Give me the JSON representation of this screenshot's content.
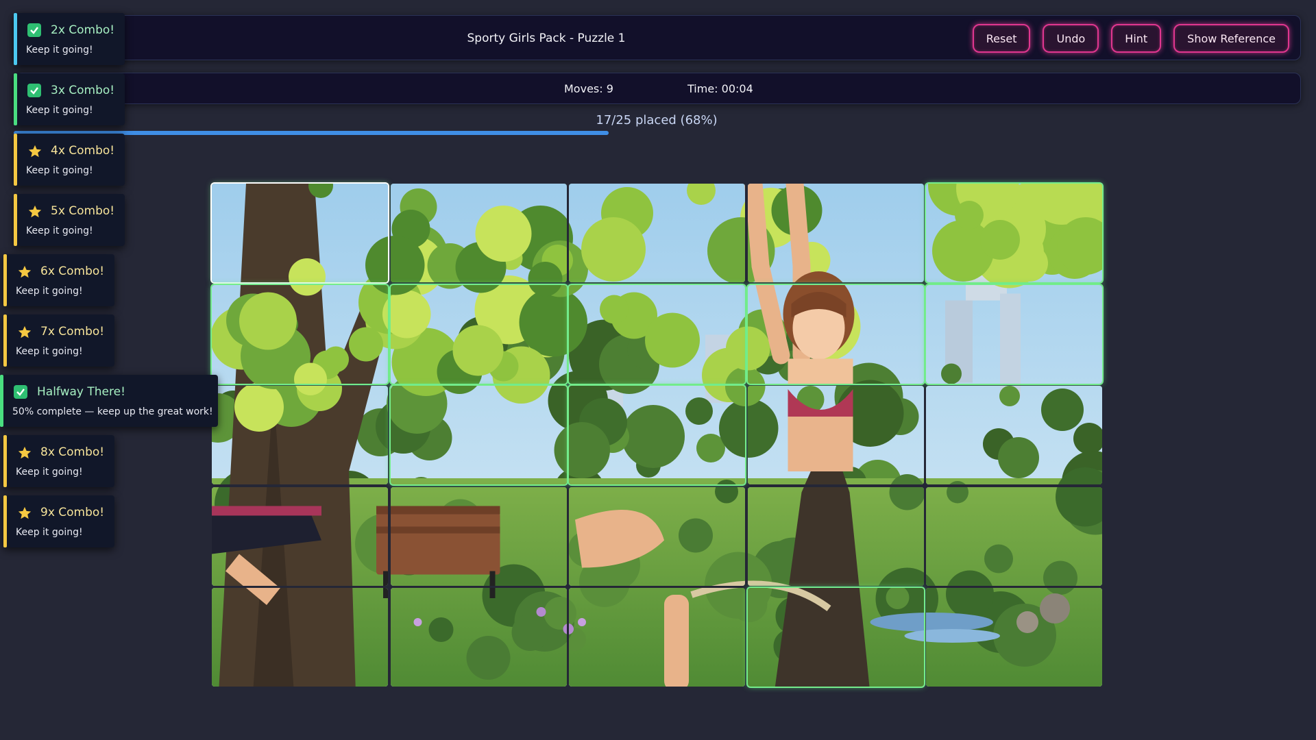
{
  "header": {
    "title": "Sporty Girls Pack - Puzzle 1",
    "buttons": {
      "reset": "Reset",
      "undo": "Undo",
      "hint": "Hint",
      "show_reference": "Show Reference"
    }
  },
  "stats": {
    "moves": "Moves: 9",
    "time": "Time: 00:04"
  },
  "progress": {
    "text": "17/25 placed (68%)",
    "fraction": 0.68
  },
  "colors": {
    "accent_pink": "#e0368f",
    "progress_blue": "#3f8ee6",
    "placed_green": "#74ec8c",
    "toast_cyan": "#4cc9f0",
    "toast_green": "#4ade80",
    "toast_gold": "#f5c842"
  },
  "toasts": [
    {
      "title": "2x Combo!",
      "message": "Keep it going!",
      "icon": "check-icon",
      "color": "#4cc9f0"
    },
    {
      "title": "3x Combo!",
      "message": "Keep it going!",
      "icon": "check-icon",
      "color": "#4ade80"
    },
    {
      "title": "4x Combo!",
      "message": "Keep it going!",
      "icon": "star-icon",
      "color": "#f5c842"
    },
    {
      "title": "5x Combo!",
      "message": "Keep it going!",
      "icon": "star-icon",
      "color": "#f5c842"
    },
    {
      "title": "6x Combo!",
      "message": "Keep it going!",
      "icon": "star-icon",
      "color": "#f5c842"
    },
    {
      "title": "7x Combo!",
      "message": "Keep it going!",
      "icon": "star-icon",
      "color": "#f5c842"
    },
    {
      "title": "Halfway There!",
      "message": "50% complete — keep up the great work!",
      "icon": "check-icon",
      "color": "#4ade80"
    },
    {
      "title": "8x Combo!",
      "message": "Keep it going!",
      "icon": "star-icon",
      "color": "#f5c842"
    },
    {
      "title": "9x Combo!",
      "message": "Keep it going!",
      "icon": "star-icon",
      "color": "#f5c842"
    }
  ],
  "tiles": [
    {
      "placed": true,
      "selected": true
    },
    {
      "placed": false
    },
    {
      "placed": false
    },
    {
      "placed": false
    },
    {
      "placed": true
    },
    {
      "placed": true
    },
    {
      "placed": true
    },
    {
      "placed": true
    },
    {
      "placed": true
    },
    {
      "placed": true
    },
    {
      "placed": false
    },
    {
      "placed": true
    },
    {
      "placed": true
    },
    {
      "placed": false
    },
    {
      "placed": false
    },
    {
      "placed": false
    },
    {
      "placed": false
    },
    {
      "placed": false
    },
    {
      "placed": false
    },
    {
      "placed": false
    },
    {
      "placed": false
    },
    {
      "placed": false
    },
    {
      "placed": false
    },
    {
      "placed": true
    },
    {
      "placed": false
    }
  ]
}
